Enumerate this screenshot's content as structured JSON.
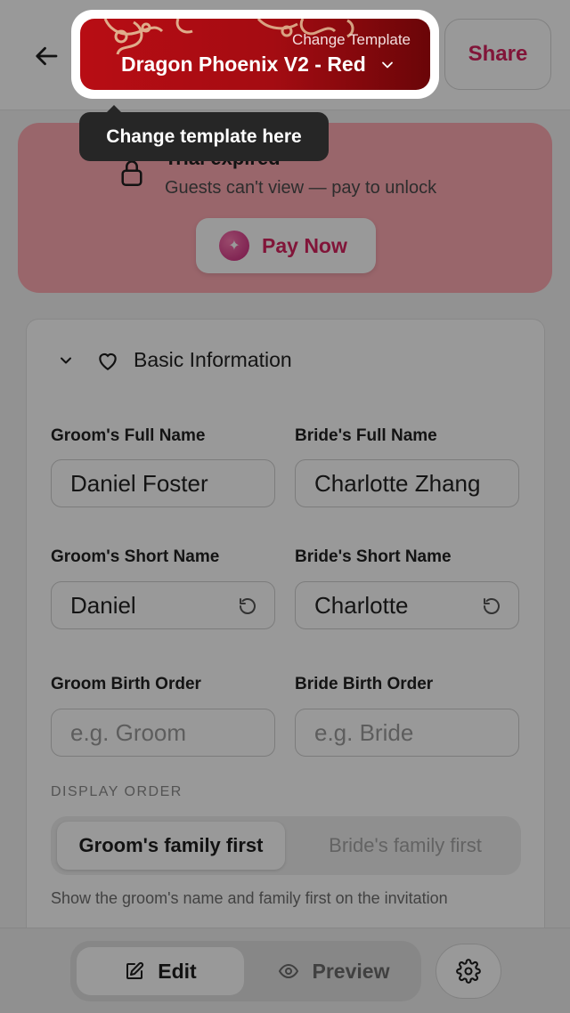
{
  "header": {
    "template_hint": "Change Template",
    "template_name": "Dragon Phoenix V2 - Red",
    "share_label": "Share"
  },
  "tooltip": {
    "text": "Change template here"
  },
  "trial": {
    "title": "Trial expired",
    "subtitle": "Guests can't view — pay to unlock",
    "pay_label": "Pay Now"
  },
  "basic_info": {
    "title": "Basic Information",
    "groom_full_name": {
      "label": "Groom's Full Name",
      "value": "Daniel Foster"
    },
    "bride_full_name": {
      "label": "Bride's Full Name",
      "value": "Charlotte Zhang"
    },
    "groom_short_name": {
      "label": "Groom's Short Name",
      "value": "Daniel"
    },
    "bride_short_name": {
      "label": "Bride's Short Name",
      "value": "Charlotte"
    },
    "groom_birth_order": {
      "label": "Groom Birth Order",
      "placeholder": "e.g. Groom"
    },
    "bride_birth_order": {
      "label": "Bride Birth Order",
      "placeholder": "e.g. Bride"
    },
    "display_order": {
      "label": "DISPLAY ORDER",
      "options": [
        "Groom's family first",
        "Bride's family first"
      ],
      "selected": "Groom's family first",
      "help": "Show the groom's name and family first on the invitation"
    }
  },
  "bottom_nav": {
    "edit_label": "Edit",
    "preview_label": "Preview",
    "active": "Edit"
  },
  "colors": {
    "accent": "#d8245f",
    "template_red": "#b80d14",
    "alert_bg": "#ffaab3",
    "tooltip_bg": "#262626"
  },
  "icons": [
    "back-arrow-icon",
    "chevron-down-icon",
    "lock-icon",
    "sparkle-icon",
    "heart-icon",
    "reset-icon",
    "pencil-icon",
    "eye-icon",
    "gear-icon"
  ]
}
